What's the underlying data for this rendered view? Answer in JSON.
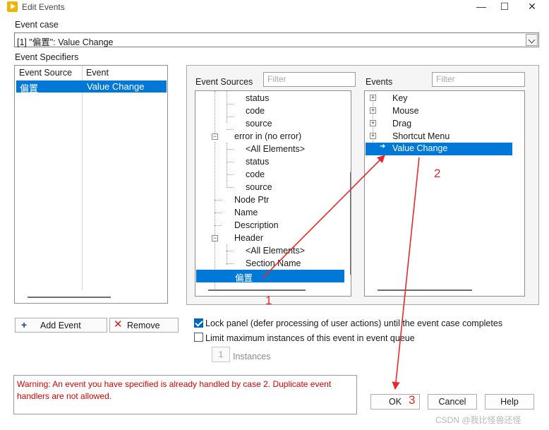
{
  "window": {
    "title": "Edit Events",
    "minimize": "—",
    "maximize": "☐",
    "close": "✕"
  },
  "event_case": {
    "label": "Event case",
    "value": "[1] \"偏置\": Value Change"
  },
  "event_specifiers": {
    "label": "Event Specifiers",
    "columns": [
      "Event Source",
      "Event"
    ],
    "rows": [
      {
        "source": "偏置",
        "event": "Value Change"
      }
    ]
  },
  "event_sources": {
    "label": "Event Sources",
    "filter_placeholder": "Filter",
    "items": [
      {
        "label": "status"
      },
      {
        "label": "code"
      },
      {
        "label": "source"
      },
      {
        "label": "error in (no error)"
      },
      {
        "label": "<All Elements>"
      },
      {
        "label": "status"
      },
      {
        "label": "code"
      },
      {
        "label": "source"
      },
      {
        "label": "Node Ptr"
      },
      {
        "label": "Name"
      },
      {
        "label": "Description"
      },
      {
        "label": "Header"
      },
      {
        "label": "<All Elements>"
      },
      {
        "label": "Section Name"
      },
      {
        "label": "偏置"
      }
    ]
  },
  "events": {
    "label": "Events",
    "filter_placeholder": "Filter",
    "items": [
      {
        "label": "Key"
      },
      {
        "label": "Mouse"
      },
      {
        "label": "Drag"
      },
      {
        "label": "Shortcut Menu"
      },
      {
        "label": "Value Change"
      }
    ]
  },
  "buttons": {
    "add_event": "Add Event",
    "remove": "Remove",
    "ok": "OK",
    "cancel": "Cancel",
    "help": "Help"
  },
  "options": {
    "lock_panel": "Lock panel (defer processing of user actions) until the event case completes",
    "limit_instances": "Limit maximum instances of this event in event queue",
    "instances_value": "1",
    "instances_label": "Instances"
  },
  "warning": "Warning:  An event you have specified is already handled by case 2. Duplicate event handlers are not allowed.",
  "annotations": [
    "1",
    "2",
    "3"
  ],
  "watermark": "CSDN @我比怪兽还怪",
  "colors": {
    "selection": "#0078d7",
    "warning": "#d70000",
    "annotation": "#e8282c"
  }
}
